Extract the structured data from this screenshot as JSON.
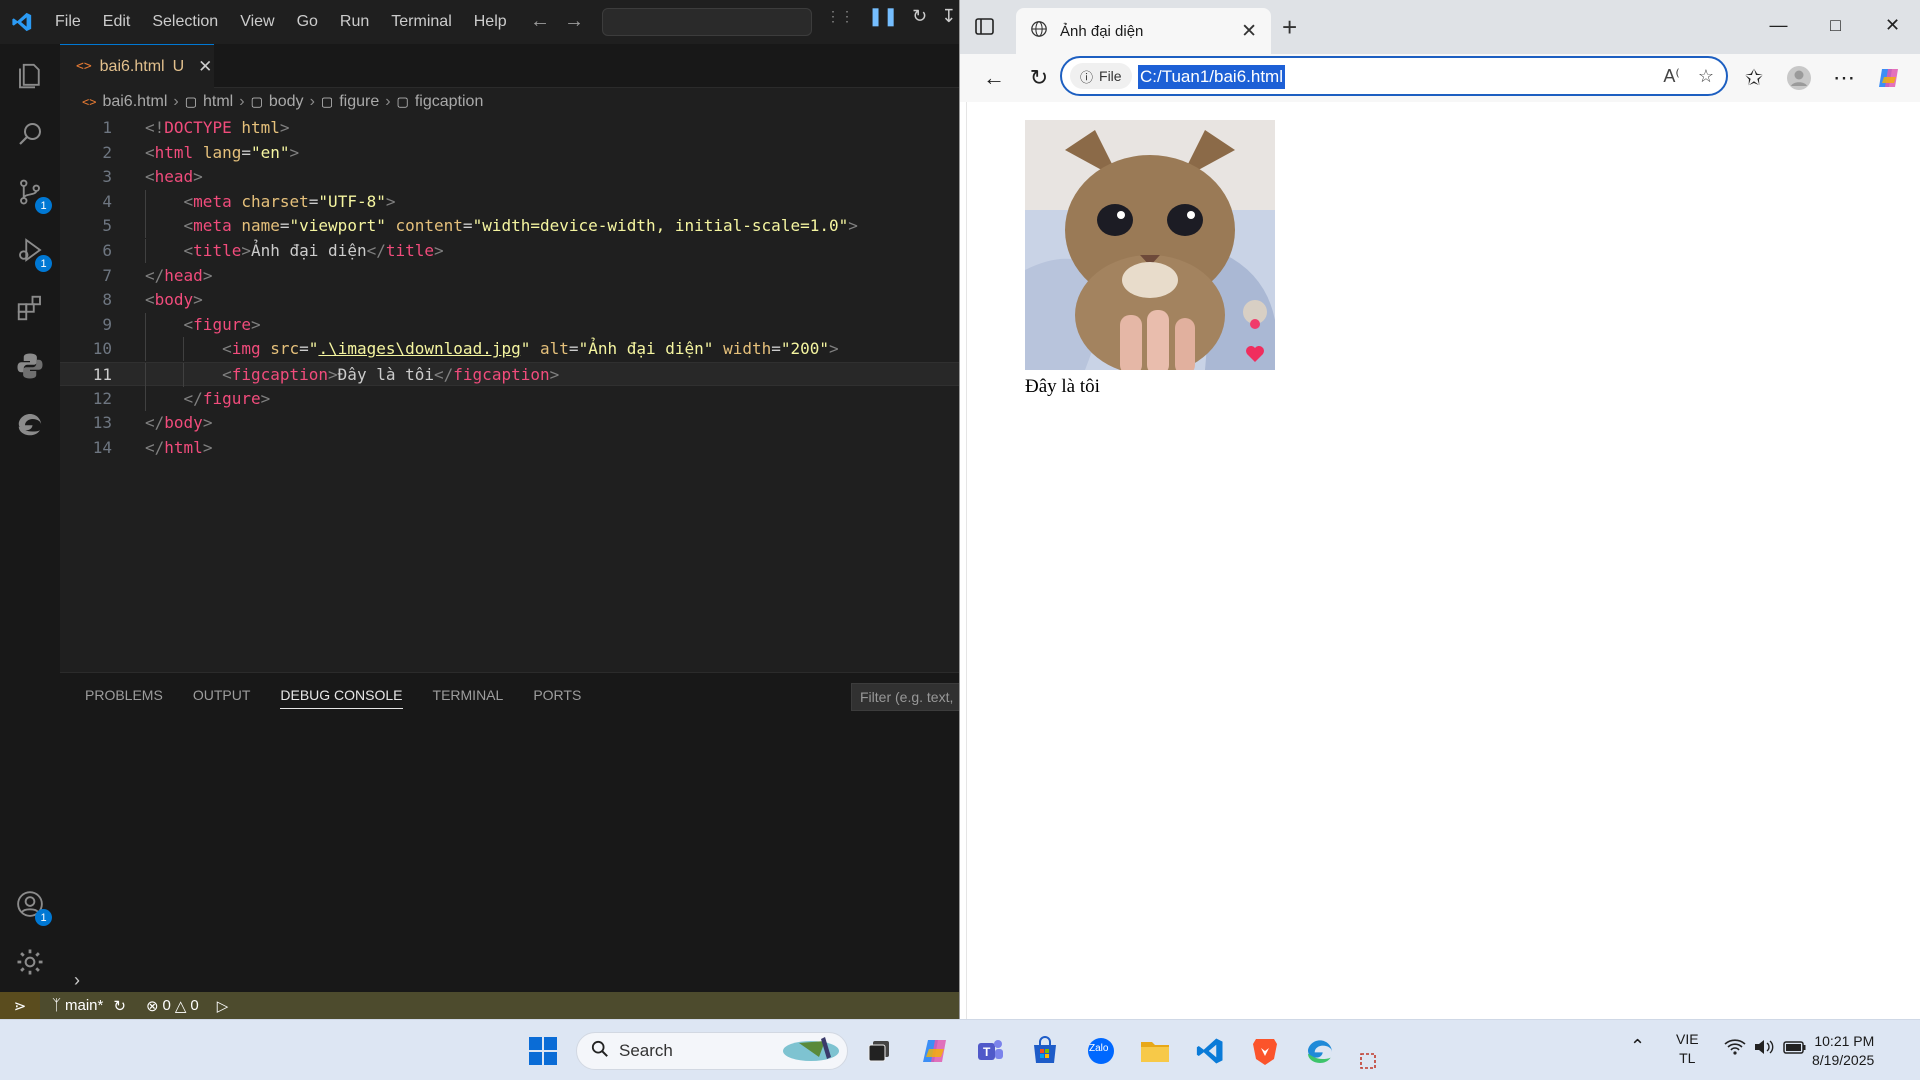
{
  "vscode": {
    "menu": [
      "File",
      "Edit",
      "Selection",
      "View",
      "Go",
      "Run",
      "Terminal",
      "Help"
    ],
    "tab": {
      "filename": "bai6.html",
      "status": "U"
    },
    "breadcrumb": [
      "bai6.html",
      "html",
      "body",
      "figure",
      "figcaption"
    ],
    "activity_badges": {
      "source_control": "1",
      "run_debug": "1",
      "accounts": "1"
    },
    "code_lines": [
      {
        "num": "1",
        "text": "<!DOCTYPE html>"
      },
      {
        "num": "2",
        "text": "<html lang=\"en\">"
      },
      {
        "num": "3",
        "text": "<head>"
      },
      {
        "num": "4",
        "text": "    <meta charset=\"UTF-8\">"
      },
      {
        "num": "5",
        "text": "    <meta name=\"viewport\" content=\"width=device-width, initial-scale=1.0\">"
      },
      {
        "num": "6",
        "text": "    <title>Ảnh đại diện</title>"
      },
      {
        "num": "7",
        "text": "</head>"
      },
      {
        "num": "8",
        "text": "<body>"
      },
      {
        "num": "9",
        "text": "    <figure>"
      },
      {
        "num": "10",
        "text": "        <img src=\".\\images\\download.jpg\" alt=\"Ảnh đại diện\" width=\"200\">"
      },
      {
        "num": "11",
        "text": "        <figcaption>Đây là tôi</figcaption>"
      },
      {
        "num": "12",
        "text": "    </figure>"
      },
      {
        "num": "13",
        "text": "</body>"
      },
      {
        "num": "14",
        "text": "</html>"
      }
    ],
    "active_line": "11",
    "panel": {
      "tabs": [
        "PROBLEMS",
        "OUTPUT",
        "DEBUG CONSOLE",
        "TERMINAL",
        "PORTS"
      ],
      "active_tab": "DEBUG CONSOLE",
      "filter_placeholder": "Filter (e.g. text,"
    },
    "statusbar": {
      "branch": "main*",
      "errors": "0",
      "warnings": "0"
    },
    "colors": {
      "tag": "#f14c7c",
      "attr": "#e5c07b",
      "string": "#f5f5a0",
      "statusbar": "#4d4b2d"
    }
  },
  "edge": {
    "tab_title": "Ảnh đại diện",
    "site_label": "File",
    "url": "C:/Tuan1/bai6.html",
    "page": {
      "figcaption": "Đây là tôi"
    }
  },
  "taskbar": {
    "search_placeholder": "Search",
    "lang_top": "VIE",
    "lang_bottom": "TL",
    "time": "10:21 PM",
    "date": "8/19/2025",
    "zalo_label": "Zalo"
  }
}
